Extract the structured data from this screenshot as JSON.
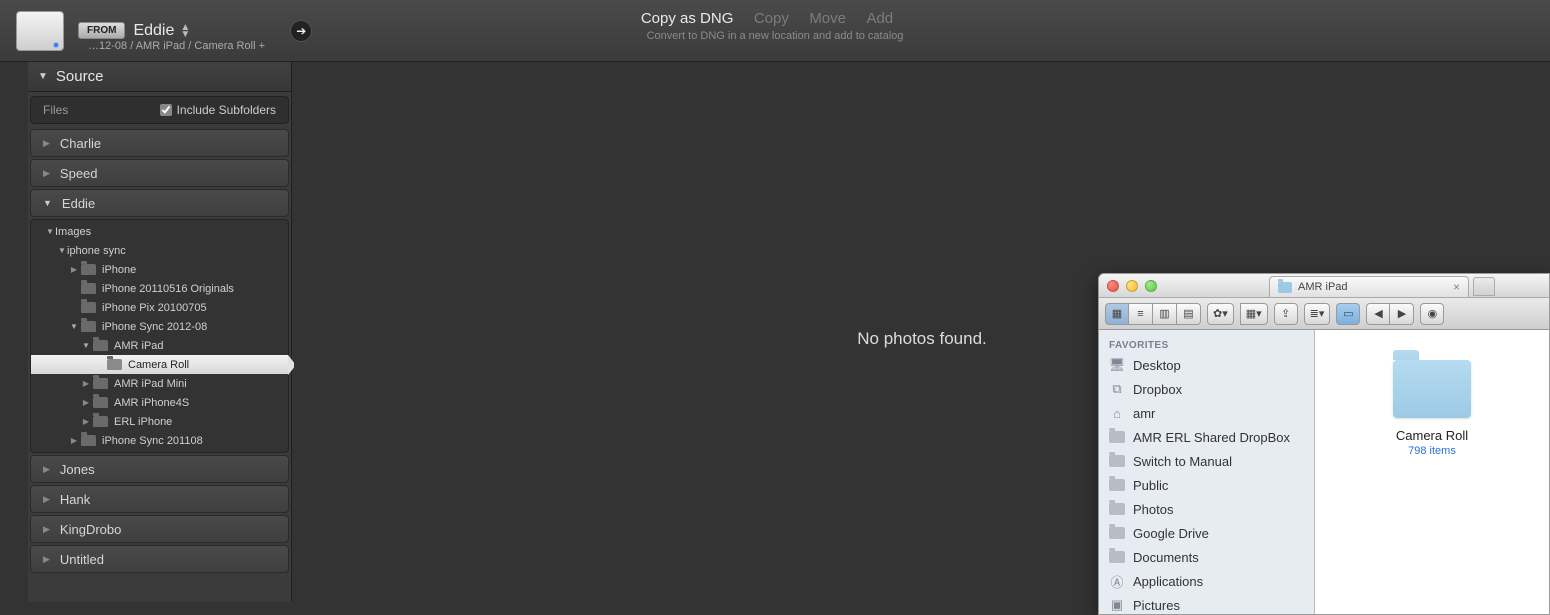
{
  "topbar": {
    "from_label": "FROM",
    "source_name": "Eddie",
    "path": "…12-08 / AMR iPad / Camera Roll +",
    "actions": {
      "primary": "Copy as DNG",
      "copy": "Copy",
      "move": "Move",
      "add": "Add",
      "subtitle": "Convert to DNG in a new location and add to catalog"
    }
  },
  "source_panel": {
    "title": "Source",
    "files_label": "Files",
    "include_label": "Include Subfolders",
    "volumes_top": [
      {
        "name": "Charlie"
      },
      {
        "name": "Speed"
      }
    ],
    "volume_expanded": "Eddie",
    "tree": {
      "l1": "Images",
      "l2": "iphone sync",
      "items": [
        {
          "name": "iPhone",
          "indent": 4,
          "expandable": true,
          "open": false
        },
        {
          "name": "iPhone 20110516 Originals",
          "indent": 4,
          "expandable": false
        },
        {
          "name": "iPhone Pix 20100705",
          "indent": 4,
          "expandable": false
        },
        {
          "name": "iPhone Sync 2012-08",
          "indent": 4,
          "expandable": true,
          "open": true
        },
        {
          "name": "AMR iPad",
          "indent": 5,
          "expandable": true,
          "open": true
        },
        {
          "name": "Camera Roll",
          "indent": 7,
          "selected": true
        },
        {
          "name": "AMR iPad Mini",
          "indent": 5,
          "expandable": true
        },
        {
          "name": "AMR iPhone4S",
          "indent": 5,
          "expandable": true
        },
        {
          "name": "ERL iPhone",
          "indent": 5,
          "expandable": true
        },
        {
          "name": "iPhone Sync 201108",
          "indent": 4,
          "expandable": true
        }
      ]
    },
    "volumes_bottom": [
      {
        "name": "Jones"
      },
      {
        "name": "Hank"
      },
      {
        "name": "KingDrobo"
      },
      {
        "name": "Untitled"
      }
    ]
  },
  "main": {
    "empty": "No photos found."
  },
  "finder": {
    "tab_title": "AMR iPad",
    "favorites_header": "FAVORITES",
    "favorites": [
      {
        "name": "Desktop",
        "icon": "desktop"
      },
      {
        "name": "Dropbox",
        "icon": "dropbox"
      },
      {
        "name": "amr",
        "icon": "home"
      },
      {
        "name": "AMR ERL Shared DropBox",
        "icon": "folder"
      },
      {
        "name": "Switch to Manual",
        "icon": "folder"
      },
      {
        "name": "Public",
        "icon": "folder"
      },
      {
        "name": "Photos",
        "icon": "folder"
      },
      {
        "name": "Google Drive",
        "icon": "folder"
      },
      {
        "name": "Documents",
        "icon": "folder"
      },
      {
        "name": "Applications",
        "icon": "apps"
      },
      {
        "name": "Pictures",
        "icon": "pictures"
      }
    ],
    "content": {
      "folder_name": "Camera Roll",
      "item_count": "798 items"
    }
  }
}
